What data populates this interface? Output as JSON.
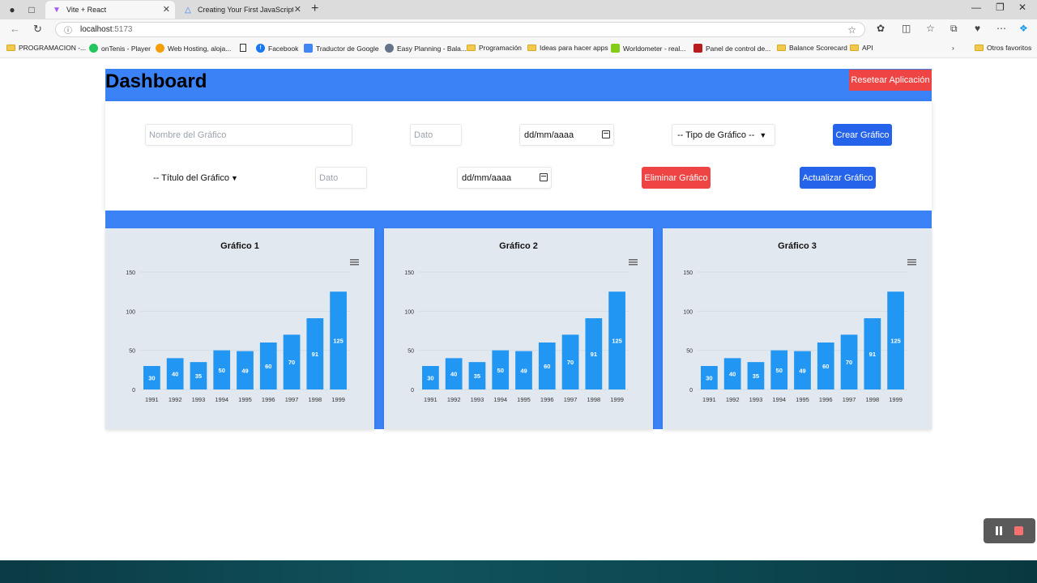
{
  "browser": {
    "tabs": [
      {
        "title": "Vite + React",
        "active": true
      },
      {
        "title": "Creating Your First JavaScript Cha",
        "active": false
      }
    ],
    "url_host": "localhost",
    "url_port": ":5173",
    "bookmarks": [
      "PROGRAMACION -...",
      "onTenis - Player",
      "Web Hosting, aloja...",
      "Facebook",
      "Traductor de Google",
      "Easy Planning - Bala...",
      "Programación",
      "Ideas para hacer apps",
      "Worldometer - real...",
      "Panel de control de...",
      "Balance Scorecard",
      "API",
      "Otros favoritos"
    ]
  },
  "app": {
    "title": "Dashboard",
    "reset_label": "Resetear Aplicación"
  },
  "form": {
    "chart_name_placeholder": "Nombre del Gráfico",
    "dato_placeholder": "Dato",
    "date_placeholder": "dd/mm/aaaa",
    "chart_type_select": "-- Tipo de Gráfico --",
    "create_label": "Crear Gráfico",
    "chart_title_select": "-- Título del Gráfico",
    "delete_label": "Eliminar Gráfico",
    "update_label": "Actualizar Gráfico"
  },
  "colors": {
    "header_blue": "#3b82f6",
    "button_blue": "#2563eb",
    "danger_red": "#ef4444",
    "bar_blue": "#2196f3",
    "card_bg": "#e1e8ef"
  },
  "chart_data": [
    {
      "type": "bar",
      "title": "Gráfico 1",
      "categories": [
        "1991",
        "1992",
        "1993",
        "1994",
        "1995",
        "1996",
        "1997",
        "1998",
        "1999"
      ],
      "values": [
        30,
        40,
        35,
        50,
        49,
        60,
        70,
        91,
        125
      ],
      "yticks": [
        0,
        50,
        100,
        150
      ],
      "ylim": [
        0,
        150
      ],
      "grid": true,
      "menu_icon": "hamburger-icon"
    },
    {
      "type": "bar",
      "title": "Gráfico 2",
      "categories": [
        "1991",
        "1992",
        "1993",
        "1994",
        "1995",
        "1996",
        "1997",
        "1998",
        "1999"
      ],
      "values": [
        30,
        40,
        35,
        50,
        49,
        60,
        70,
        91,
        125
      ],
      "yticks": [
        0,
        50,
        100,
        150
      ],
      "ylim": [
        0,
        150
      ],
      "grid": true,
      "menu_icon": "hamburger-icon"
    },
    {
      "type": "bar",
      "title": "Gráfico 3",
      "categories": [
        "1991",
        "1992",
        "1993",
        "1994",
        "1995",
        "1996",
        "1997",
        "1998",
        "1999"
      ],
      "values": [
        30,
        40,
        35,
        50,
        49,
        60,
        70,
        91,
        125
      ],
      "yticks": [
        0,
        50,
        100,
        150
      ],
      "ylim": [
        0,
        150
      ],
      "grid": true,
      "menu_icon": "hamburger-icon"
    }
  ]
}
